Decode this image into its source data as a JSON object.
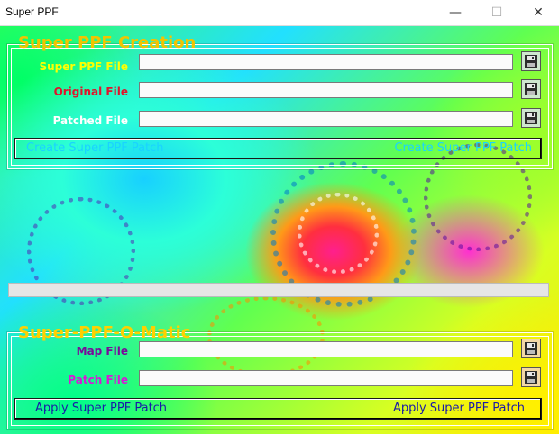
{
  "window": {
    "title": "Super PPF",
    "minimize_glyph": "—",
    "maximize_glyph": "☐",
    "close_glyph": "✕"
  },
  "creation": {
    "legend": "Super PPF Creation",
    "fields": [
      {
        "label": "Super PPF File",
        "value": "",
        "label_color": "#ffff00",
        "icon": "floppy-disk-icon"
      },
      {
        "label": "Original File",
        "value": "",
        "label_color": "#e0142c",
        "icon": "floppy-disk-icon"
      },
      {
        "label": "Patched File",
        "value": "",
        "label_color": "#ffffff",
        "icon": "floppy-disk-icon"
      }
    ],
    "button_text_left": "Create Super PPF Patch",
    "button_text_right": "Create Super PPF Patch"
  },
  "progress": {
    "value": 0
  },
  "ometic": {
    "legend": "Super-PPF-O-Matic",
    "fields": [
      {
        "label": "Map File",
        "value": "",
        "label_color": "#7a0a9a",
        "icon": "floppy-disk-icon"
      },
      {
        "label": "Patch File",
        "value": "",
        "label_color": "#d61ad6",
        "icon": "floppy-disk-icon"
      }
    ],
    "button_text_left": "Apply Super PPF Patch",
    "button_text_right": "Apply Super PPF Patch"
  },
  "colors": {
    "creation_legend": "#f2c400",
    "creation_button_text": "#1ad3ff",
    "ometic_legend": "#ffd000",
    "ometic_button_text": "#1a1aa8"
  }
}
